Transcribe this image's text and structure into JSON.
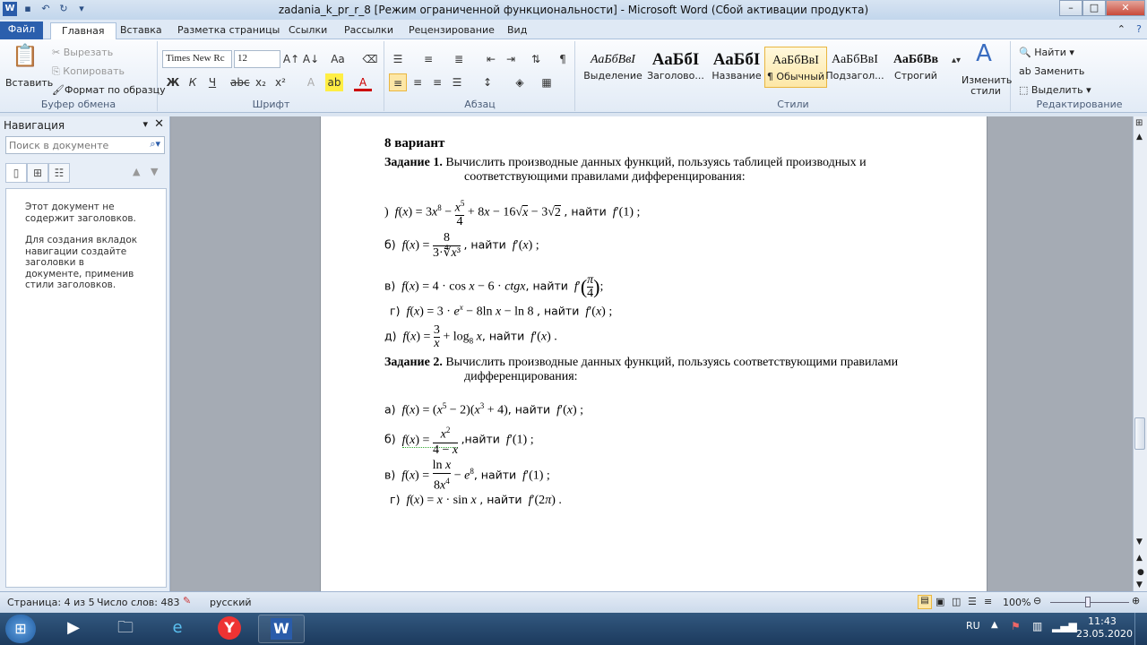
{
  "window": {
    "title": "zadania_k_pr_r_8 [Режим ограниченной функциональности]  -  Microsoft Word (Сбой активации продукта)"
  },
  "ribbon_tabs": [
    "Файл",
    "Главная",
    "Вставка",
    "Разметка страницы",
    "Ссылки",
    "Рассылки",
    "Рецензирование",
    "Вид"
  ],
  "clipboard": {
    "paste": "Вставить",
    "cut": "Вырезать",
    "copy": "Копировать",
    "format_painter": "Формат по образцу",
    "label": "Буфер обмена"
  },
  "font": {
    "name": "Times New Rc",
    "size": "12",
    "label": "Шрифт"
  },
  "paragraph": {
    "label": "Абзац"
  },
  "styles": {
    "items": [
      {
        "preview": "АаБбВвІ",
        "name": "Выделение"
      },
      {
        "preview": "АаБбІ",
        "name": "Заголово..."
      },
      {
        "preview": "АаБбІ",
        "name": "Название"
      },
      {
        "preview": "АаБбВвІ",
        "name": "¶ Обычный"
      },
      {
        "preview": "АаБбВвІ",
        "name": "Подзагол..."
      },
      {
        "preview": "АаБбВв",
        "name": "Строгий"
      }
    ],
    "change": "Изменить стили",
    "label": "Стили"
  },
  "editing": {
    "find": "Найти",
    "replace": "Заменить",
    "select": "Выделить",
    "label": "Редактирование"
  },
  "nav": {
    "title": "Навигация",
    "search_placeholder": "Поиск в документе",
    "msg1": "Этот документ не содержит заголовков.",
    "msg2": "Для создания вкладок навигации создайте заголовки в документе, применив стили заголовков."
  },
  "doc": {
    "variant": "8 вариант",
    "task1_label": "Задание 1.",
    "task1_text": "Вычислить производные данных функций, пользуясь таблицей производных и",
    "task1_cont": "соответствующими правилами дифференцирования:",
    "task2_label": "Задание 2.",
    "task2_text": "Вычислить производные данных функций, пользуясь соответствующими правилами",
    "task2_cont": "дифференцирования:",
    "find": "найти"
  },
  "status": {
    "page": "Страница: 4 из 5",
    "words": "Число слов: 483",
    "lang": "русский",
    "zoom": "100%"
  },
  "tray": {
    "lang": "RU",
    "time": "11:43",
    "date": "23.05.2020"
  }
}
